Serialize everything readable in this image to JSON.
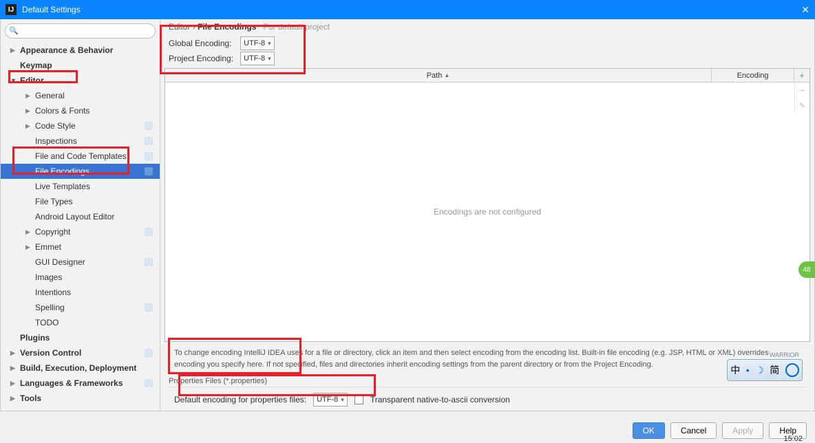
{
  "window": {
    "title": "Default Settings"
  },
  "search": {
    "placeholder": ""
  },
  "sidebar": {
    "items": [
      {
        "label": "Appearance & Behavior",
        "bold": true,
        "arrow": "right"
      },
      {
        "label": "Keymap",
        "bold": true
      },
      {
        "label": "Editor",
        "bold": true,
        "arrow": "down"
      },
      {
        "label": "General",
        "sub": true,
        "arrow": "right"
      },
      {
        "label": "Colors & Fonts",
        "sub": true,
        "arrow": "right"
      },
      {
        "label": "Code Style",
        "sub": true,
        "arrow": "right",
        "badge": true
      },
      {
        "label": "Inspections",
        "sub": true,
        "badge": true
      },
      {
        "label": "File and Code Templates",
        "sub": true,
        "badge": true
      },
      {
        "label": "File Encodings",
        "sub": true,
        "selected": true,
        "badge": true
      },
      {
        "label": "Live Templates",
        "sub": true
      },
      {
        "label": "File Types",
        "sub": true
      },
      {
        "label": "Android Layout Editor",
        "sub": true
      },
      {
        "label": "Copyright",
        "sub": true,
        "arrow": "right",
        "badge": true
      },
      {
        "label": "Emmet",
        "sub": true,
        "arrow": "right"
      },
      {
        "label": "GUI Designer",
        "sub": true,
        "badge": true
      },
      {
        "label": "Images",
        "sub": true
      },
      {
        "label": "Intentions",
        "sub": true
      },
      {
        "label": "Spelling",
        "sub": true,
        "badge": true
      },
      {
        "label": "TODO",
        "sub": true
      },
      {
        "label": "Plugins",
        "bold": true
      },
      {
        "label": "Version Control",
        "bold": true,
        "arrow": "right",
        "badge": true
      },
      {
        "label": "Build, Execution, Deployment",
        "bold": true,
        "arrow": "right"
      },
      {
        "label": "Languages & Frameworks",
        "bold": true,
        "arrow": "right",
        "badge": true
      },
      {
        "label": "Tools",
        "bold": true,
        "arrow": "right"
      }
    ]
  },
  "breadcrumb": {
    "section": "Editor",
    "page": "File Encodings",
    "suffix": "For default project"
  },
  "encoding": {
    "global_label": "Global Encoding:",
    "global_value": "UTF-8",
    "project_label": "Project Encoding:",
    "project_value": "UTF-8"
  },
  "table": {
    "col_path": "Path",
    "col_encoding": "Encoding",
    "empty_msg": "Encodings are not configured"
  },
  "hint": "To change encoding IntelliJ IDEA uses for a file or directory, click an item and then select encoding from the encoding list. Built-in file encoding (e.g. JSP, HTML or XML) overrides encoding you specify here. If not specified, files and directories inherit encoding settings from the parent directory or from the Project Encoding.",
  "properties": {
    "title": "Properties Files (*.properties)",
    "default_label": "Default encoding for properties files:",
    "default_value": "UTF-8",
    "checkbox_label": "Transparent native-to-ascii conversion"
  },
  "buttons": {
    "ok": "OK",
    "cancel": "Cancel",
    "apply": "Apply",
    "help": "Help"
  },
  "badge_48": "48",
  "ime": {
    "zhong": "中",
    "jian": "简"
  },
  "warrior": "WARRIOR",
  "clock": "15:02"
}
